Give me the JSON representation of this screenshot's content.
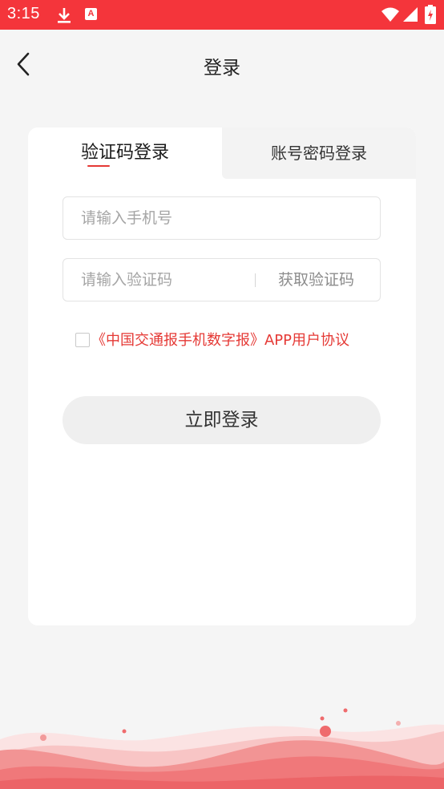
{
  "status_bar": {
    "time": "3:15",
    "icons": [
      "download-icon",
      "a-app-icon",
      "wifi-icon",
      "signal-icon",
      "battery-icon"
    ],
    "app_badge": "A"
  },
  "nav": {
    "title": "登录",
    "back_icon": "chevron-left-icon"
  },
  "tabs": {
    "code_login": "验证码登录",
    "password_login": "账号密码登录",
    "active": "code_login"
  },
  "form": {
    "phone_placeholder": "请输入手机号",
    "phone_value": "",
    "code_placeholder": "请输入验证码",
    "code_value": "",
    "get_code_label": "获取验证码",
    "agreement_text": "《中国交通报手机数字报》APP用户协议",
    "agreement_checked": false,
    "login_label": "立即登录"
  },
  "colors": {
    "brand_red": "#f4353b",
    "link_red": "#e53935",
    "page_bg": "#f5f5f5",
    "card_bg": "#ffffff"
  }
}
